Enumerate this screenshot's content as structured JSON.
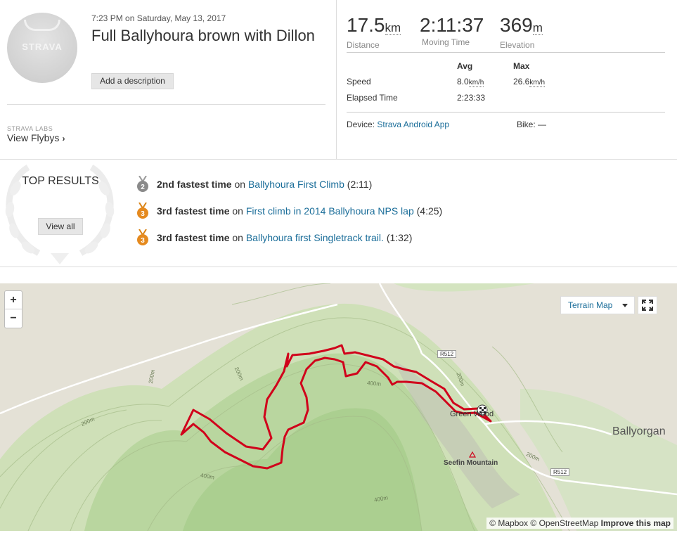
{
  "activity": {
    "avatar_logo": "STRAVA",
    "date": "7:23 PM on Saturday, May 13, 2017",
    "title": "Full Ballyhoura brown with Dillon",
    "add_description": "Add a description",
    "labs_label": "STRAVA LABS",
    "flybys": "View Flybys"
  },
  "stats": {
    "distance": {
      "value": "17.5",
      "unit": "km",
      "label": "Distance"
    },
    "moving_time": {
      "value": "2:11:37",
      "label": "Moving Time"
    },
    "elevation": {
      "value": "369",
      "unit": "m",
      "label": "Elevation"
    },
    "headers": {
      "avg": "Avg",
      "max": "Max"
    },
    "speed": {
      "label": "Speed",
      "avg": "8.0",
      "max": "26.6",
      "unit": "km/h"
    },
    "elapsed": {
      "label": "Elapsed Time",
      "avg": "2:23:33"
    },
    "device_label": "Device:",
    "device": "Strava Android App",
    "bike_label": "Bike:",
    "bike": "—"
  },
  "top_results": {
    "title": "TOP RESULTS",
    "view_all": "View all",
    "efforts": [
      {
        "rank_label": "2nd fastest time",
        "on": "on",
        "segment": "Ballyhoura First Climb",
        "time": "(2:11)",
        "rank": "2",
        "medal_color": "#8a8a8a"
      },
      {
        "rank_label": "3rd fastest time",
        "on": "on",
        "segment": "First climb in 2014 Ballyhoura NPS lap",
        "time": "(4:25)",
        "rank": "3",
        "medal_color": "#e58a1f"
      },
      {
        "rank_label": "3rd fastest time",
        "on": "on",
        "segment": "Ballyhoura first Singletrack trail.",
        "time": "(1:32)",
        "rank": "3",
        "medal_color": "#e58a1f"
      }
    ]
  },
  "map": {
    "zoom_in": "+",
    "zoom_out": "−",
    "terrain": "Terrain Map",
    "town": "Ballyorgan",
    "green_wood": "Green Wood",
    "mountain": "Seefin Mountain",
    "road1": "R512",
    "road2": "R512",
    "contours": [
      "200m",
      "200m",
      "200m",
      "400m",
      "400m",
      "200m",
      "200m",
      "400m"
    ],
    "attribution": {
      "mapbox": "© Mapbox",
      "osm": "© OpenStreetMap",
      "improve": "Improve this map"
    },
    "route_color": "#d0021b"
  }
}
